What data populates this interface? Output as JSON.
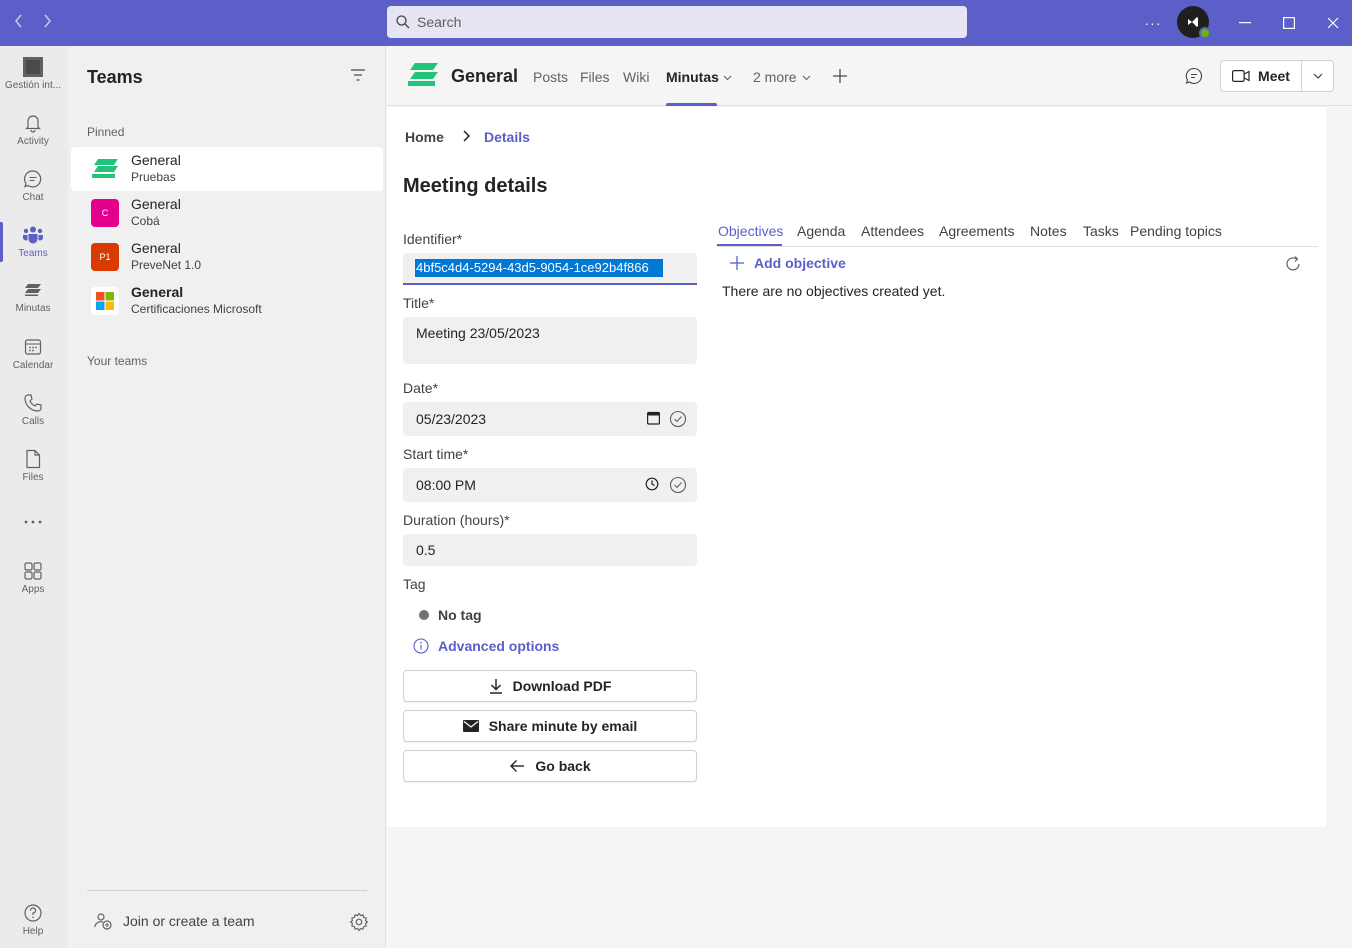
{
  "titlebar": {
    "search_placeholder": "Search",
    "more_label": "···",
    "accent": "#5b5fc7"
  },
  "rail": {
    "items": [
      {
        "label": "Gestión int...",
        "icon": "org-app-icon"
      },
      {
        "label": "Activity",
        "icon": "bell-icon"
      },
      {
        "label": "Chat",
        "icon": "chat-icon"
      },
      {
        "label": "Teams",
        "icon": "teams-icon",
        "active": true
      },
      {
        "label": "Minutas",
        "icon": "minutas-icon"
      },
      {
        "label": "Calendar",
        "icon": "calendar-icon"
      },
      {
        "label": "Calls",
        "icon": "phone-icon"
      },
      {
        "label": "Files",
        "icon": "file-icon"
      },
      {
        "label": "Apps",
        "icon": "apps-icon"
      },
      {
        "label": "Help",
        "icon": "help-icon"
      }
    ]
  },
  "pane": {
    "title": "Teams",
    "pinned_label": "Pinned",
    "your_teams_label": "Your teams",
    "channels": [
      {
        "name": "General",
        "team": "Pruebas",
        "selected": true
      },
      {
        "name": "General",
        "team": "Cobá",
        "badge": "C",
        "color": "#e3008c"
      },
      {
        "name": "General",
        "team": "PreveNet 1.0",
        "badge": "P1",
        "color": "#d83b01"
      },
      {
        "name": "General",
        "team": "Certificaciones Microsoft",
        "bold": true
      }
    ],
    "join_label": "Join or create a team"
  },
  "header": {
    "channel": "General",
    "tabs": [
      "Posts",
      "Files",
      "Wiki",
      "Minutas",
      "2 more"
    ],
    "meet_label": "Meet"
  },
  "content": {
    "breadcrumb_home": "Home",
    "breadcrumb_current": "Details",
    "title": "Meeting details",
    "identifier_label": "Identifier*",
    "identifier_value": "4bf5c4d4-5294-43d5-9054-1ce92b4f866",
    "title_label": "Title*",
    "title_value": "Meeting  23/05/2023",
    "date_label": "Date*",
    "date_value": "05/23/2023",
    "start_label": "Start time*",
    "start_value": "08:00  PM",
    "duration_label": "Duration (hours)*",
    "duration_value": "0.5",
    "tag_label": "Tag",
    "tag_value": "No tag",
    "advanced_label": "Advanced options",
    "download_label": "Download PDF",
    "share_label": "Share minute by email",
    "back_label": "Go back",
    "right_tabs": [
      "Objectives",
      "Agenda",
      "Attendees",
      "Agreements",
      "Notes",
      "Tasks",
      "Pending topics"
    ],
    "add_objective_label": "Add objective",
    "empty_message": "There are no objectives created yet."
  }
}
